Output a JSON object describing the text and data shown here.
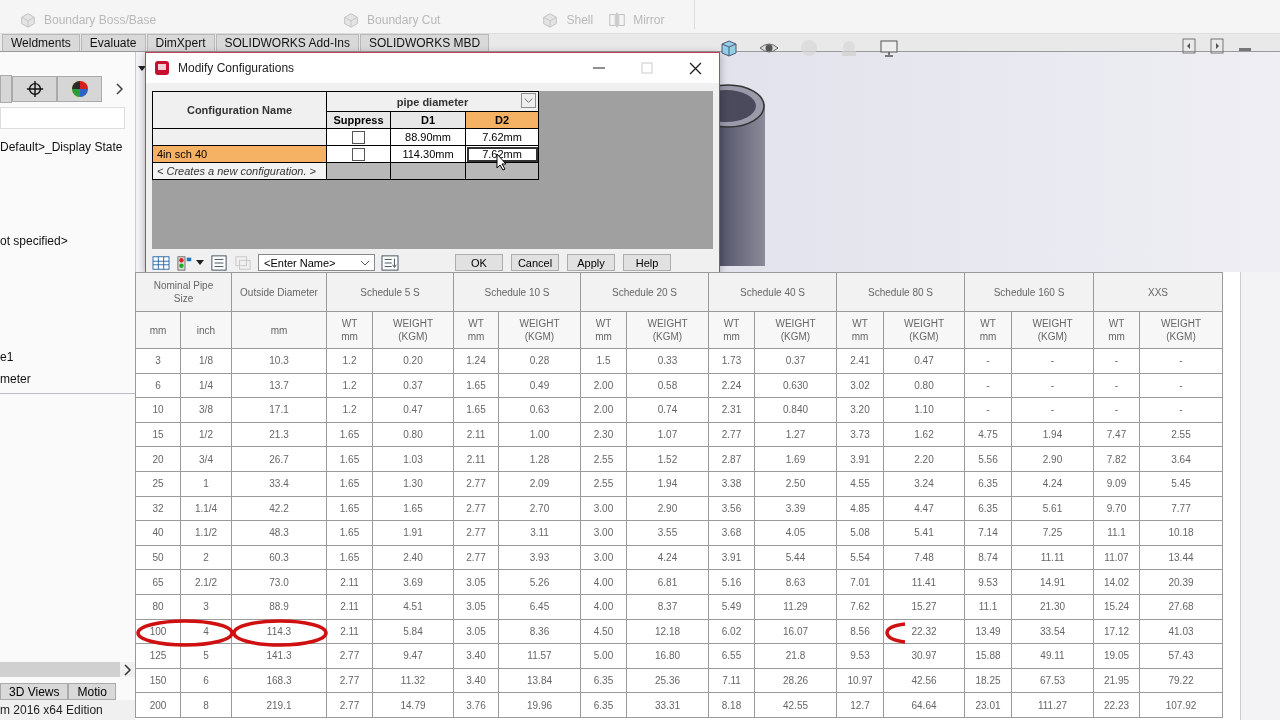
{
  "ribbon": {
    "commands": [
      {
        "label": "Boundary Boss/Base",
        "kind": "boss"
      },
      {
        "label": "Boundary Cut",
        "kind": "cut"
      },
      {
        "label": "Shell",
        "kind": "shell"
      },
      {
        "label": "Mirror",
        "kind": "mirror"
      }
    ]
  },
  "command_tabs": [
    "Weldments",
    "Evaluate",
    "DimXpert",
    "SOLIDWORKS Add-Ins",
    "SOLIDWORKS MBD"
  ],
  "feature_tree": {
    "items": [
      "Default>_Display State",
      "ot specified>",
      "e1",
      "meter"
    ]
  },
  "bottom_tabs": [
    "3D Views",
    "Motio"
  ],
  "status_bar": "m 2016 x64 Edition",
  "dialog": {
    "title": "Modify Configurations",
    "name_header": "Configuration Name",
    "group_header": "pipe diameter",
    "columns": [
      {
        "label": "Suppress",
        "selected": false
      },
      {
        "label": "D1",
        "selected": false
      },
      {
        "label": "D2",
        "selected": true
      }
    ],
    "rows": [
      {
        "name": "",
        "suppress": false,
        "d1": "88.90mm",
        "d2": "7.62mm",
        "selected": false
      },
      {
        "name": "4in sch 40",
        "suppress": false,
        "d1": "114.30mm",
        "d2": "7.62mm",
        "selected": true
      }
    ],
    "new_row": "< Creates a new configuration. >",
    "name_select": "<Enter Name>",
    "buttons": [
      "OK",
      "Cancel",
      "Apply",
      "Help"
    ]
  },
  "pipe_table": {
    "group_headers": [
      "Nominal Pipe Size",
      "Outside Diameter",
      "Schedule 5 S",
      "Schedule 10 S",
      "Schedule 20 S",
      "Schedule 40 S",
      "Schedule 80 S",
      "Schedule 160 S",
      "XXS"
    ],
    "sub_headers": [
      "mm",
      "inch",
      "mm",
      "WT\nmm",
      "WEIGHT\n(KGM)",
      "WT\nmm",
      "WEIGHT\n(KGM)",
      "WT\nmm",
      "WEIGHT\n(KGM)",
      "WT\nmm",
      "WEIGHT\n(KGM)",
      "WT\nmm",
      "WEIGHT\n(KGM)",
      "WT\nmm",
      "WEIGHT\n(KGM)",
      "WT\nmm",
      "WEIGHT\n(KGM)"
    ],
    "rows": [
      [
        "3",
        "1/8",
        "10.3",
        "1.2",
        "0.20",
        "1.24",
        "0.28",
        "1.5",
        "0.33",
        "1.73",
        "0.37",
        "2.41",
        "0.47",
        "-",
        "-",
        "-",
        "-"
      ],
      [
        "6",
        "1/4",
        "13.7",
        "1.2",
        "0.37",
        "1.65",
        "0.49",
        "2.00",
        "0.58",
        "2.24",
        "0.630",
        "3.02",
        "0.80",
        "-",
        "-",
        "-",
        "-"
      ],
      [
        "10",
        "3/8",
        "17.1",
        "1.2",
        "0.47",
        "1.65",
        "0.63",
        "2.00",
        "0.74",
        "2.31",
        "0.840",
        "3.20",
        "1.10",
        "-",
        "-",
        "-",
        "-"
      ],
      [
        "15",
        "1/2",
        "21.3",
        "1.65",
        "0.80",
        "2.11",
        "1.00",
        "2.30",
        "1.07",
        "2.77",
        "1.27",
        "3.73",
        "1.62",
        "4.75",
        "1.94",
        "7.47",
        "2.55"
      ],
      [
        "20",
        "3/4",
        "26.7",
        "1.65",
        "1.03",
        "2.11",
        "1.28",
        "2.55",
        "1.52",
        "2.87",
        "1.69",
        "3.91",
        "2.20",
        "5.56",
        "2.90",
        "7.82",
        "3.64"
      ],
      [
        "25",
        "1",
        "33.4",
        "1.65",
        "1.30",
        "2.77",
        "2.09",
        "2.55",
        "1.94",
        "3.38",
        "2.50",
        "4.55",
        "3.24",
        "6.35",
        "4.24",
        "9.09",
        "5.45"
      ],
      [
        "32",
        "1.1/4",
        "42.2",
        "1.65",
        "1.65",
        "2.77",
        "2.70",
        "3.00",
        "2.90",
        "3.56",
        "3.39",
        "4.85",
        "4.47",
        "6.35",
        "5.61",
        "9.70",
        "7.77"
      ],
      [
        "40",
        "1.1/2",
        "48.3",
        "1.65",
        "1.91",
        "2.77",
        "3.11",
        "3.00",
        "3.55",
        "3.68",
        "4.05",
        "5.08",
        "5.41",
        "7.14",
        "7.25",
        "11.1",
        "10.18"
      ],
      [
        "50",
        "2",
        "60.3",
        "1.65",
        "2.40",
        "2.77",
        "3.93",
        "3.00",
        "4.24",
        "3.91",
        "5.44",
        "5.54",
        "7.48",
        "8.74",
        "11.11",
        "11.07",
        "13.44"
      ],
      [
        "65",
        "2.1/2",
        "73.0",
        "2.11",
        "3.69",
        "3.05",
        "5.26",
        "4.00",
        "6.81",
        "5.16",
        "8.63",
        "7.01",
        "11.41",
        "9.53",
        "14.91",
        "14.02",
        "20.39"
      ],
      [
        "80",
        "3",
        "88.9",
        "2.11",
        "4.51",
        "3.05",
        "6.45",
        "4.00",
        "8.37",
        "5.49",
        "11.29",
        "7.62",
        "15.27",
        "11.1",
        "21.30",
        "15.24",
        "27.68"
      ],
      [
        "100",
        "4",
        "114.3",
        "2.11",
        "5.84",
        "3.05",
        "8.36",
        "4.50",
        "12.18",
        "6.02",
        "16.07",
        "8.56",
        "22.32",
        "13.49",
        "33.54",
        "17.12",
        "41.03"
      ],
      [
        "125",
        "5",
        "141.3",
        "2.77",
        "9.47",
        "3.40",
        "11.57",
        "5.00",
        "16.80",
        "6.55",
        "21.8",
        "9.53",
        "30.97",
        "15.88",
        "49.11",
        "19.05",
        "57.43"
      ],
      [
        "150",
        "6",
        "168.3",
        "2.77",
        "11.32",
        "3.40",
        "13.84",
        "6.35",
        "25.36",
        "7.11",
        "28.26",
        "10.97",
        "42.56",
        "18.25",
        "67.53",
        "21.95",
        "79.22"
      ],
      [
        "200",
        "8",
        "219.1",
        "2.77",
        "14.79",
        "3.76",
        "19.96",
        "6.35",
        "33.31",
        "8.18",
        "42.55",
        "12.7",
        "64.64",
        "23.01",
        "111.27",
        "22.23",
        "107.92"
      ]
    ]
  }
}
